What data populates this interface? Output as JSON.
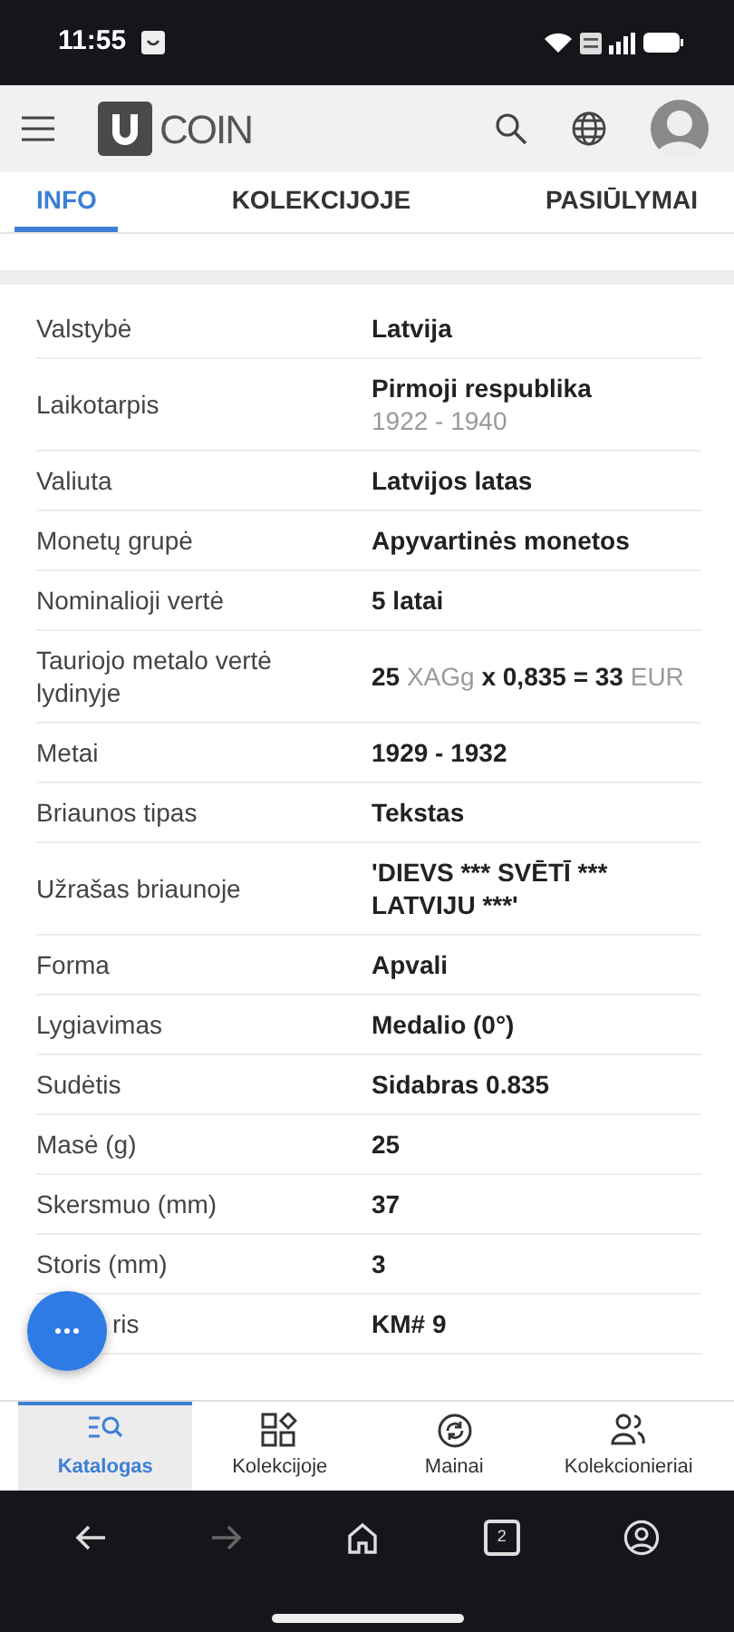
{
  "status_bar": {
    "time": "11:55"
  },
  "app_bar": {
    "logo_text": "COIN"
  },
  "tabs": [
    {
      "label": "INFO",
      "selected": true
    },
    {
      "label": "KOLEKCIJOJE",
      "selected": false
    },
    {
      "label": "PASIŪLYMAI",
      "selected": false
    }
  ],
  "details": [
    {
      "label": "Valstybė",
      "value": [
        {
          "text": "Latvija",
          "muted": false
        }
      ]
    },
    {
      "label": "Laikotarpis",
      "value": [
        {
          "text": "Pirmoji respublika",
          "muted": false
        }
      ],
      "sub": "1922 - 1940"
    },
    {
      "label": "Valiuta",
      "value": [
        {
          "text": "Latvijos latas",
          "muted": false
        }
      ]
    },
    {
      "label": "Monetų grupė",
      "value": [
        {
          "text": "Apyvartinės monetos",
          "muted": false
        }
      ]
    },
    {
      "label": "Nominalioji vertė",
      "value": [
        {
          "text": "5 latai",
          "muted": false
        }
      ]
    },
    {
      "label": "Tauriojo metalo vertė lydinyje",
      "value": [
        {
          "text": "25 ",
          "muted": false
        },
        {
          "text": "XAGg",
          "muted": true
        },
        {
          "text": " x 0,835 = 33 ",
          "muted": false
        },
        {
          "text": "EUR",
          "muted": true
        }
      ]
    },
    {
      "label": "Metai",
      "value": [
        {
          "text": "1929 - 1932",
          "muted": false
        }
      ]
    },
    {
      "label": "Briaunos tipas",
      "value": [
        {
          "text": "Tekstas",
          "muted": false
        }
      ]
    },
    {
      "label": "Užrašas briaunoje",
      "value": [
        {
          "text": "'DIEVS *** SVĒTĪ *** LATVIJU ***'",
          "muted": false
        }
      ]
    },
    {
      "label": "Forma",
      "value": [
        {
          "text": "Apvali",
          "muted": false
        }
      ]
    },
    {
      "label": "Lygiavimas",
      "value": [
        {
          "text": "Medalio (0°)",
          "muted": false
        }
      ]
    },
    {
      "label": "Sudėtis",
      "value": [
        {
          "text": "Sidabras 0.835",
          "muted": false
        }
      ]
    },
    {
      "label": "Masė (g)",
      "value": [
        {
          "text": "25",
          "muted": false
        }
      ]
    },
    {
      "label": "Skersmuo (mm)",
      "value": [
        {
          "text": "37",
          "muted": false
        }
      ]
    },
    {
      "label": "Storis (mm)",
      "value": [
        {
          "text": "3",
          "muted": false
        }
      ]
    },
    {
      "label": "ris",
      "value": [
        {
          "text": "KM# 9",
          "muted": false
        }
      ]
    }
  ],
  "bottom_nav": [
    {
      "label": "Katalogas",
      "selected": true,
      "kind": "catalog"
    },
    {
      "label": "Kolekcijoje",
      "selected": false,
      "kind": "collection"
    },
    {
      "label": "Mainai",
      "selected": false,
      "kind": "exchange"
    },
    {
      "label": "Kolekcionieriai",
      "selected": false,
      "kind": "collectors"
    }
  ],
  "browser_bar": {
    "tab_count": "2"
  }
}
